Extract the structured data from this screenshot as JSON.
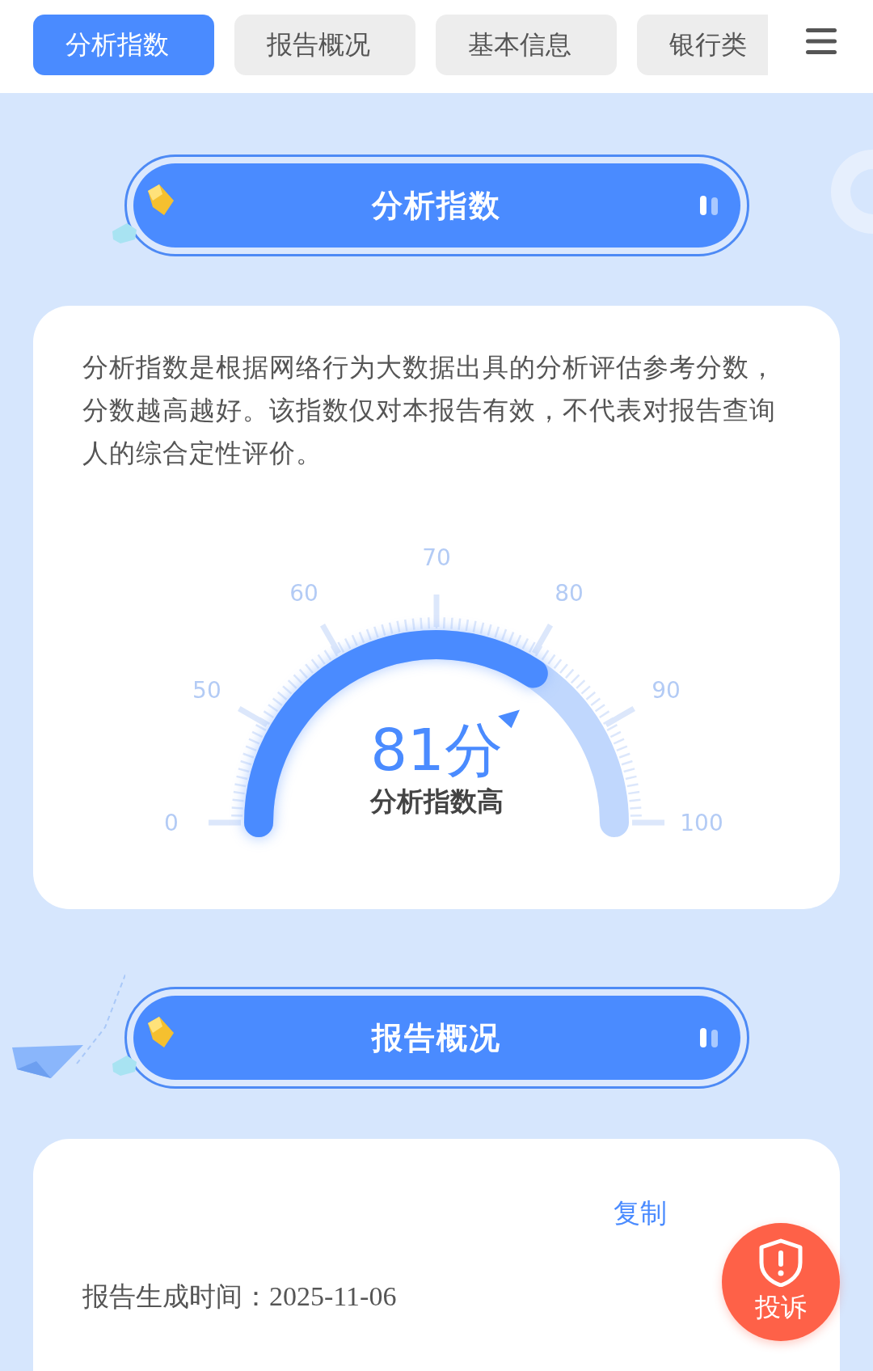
{
  "nav": {
    "tabs": [
      {
        "label": "分析指数",
        "selected": true
      },
      {
        "label": "报告概况",
        "selected": false
      },
      {
        "label": "基本信息",
        "selected": false
      },
      {
        "label": "银行类",
        "selected": false
      }
    ]
  },
  "sections": [
    {
      "kind": "score",
      "title": "分析指数",
      "description": "分析指数是根据网络行为大数据出具的分析评估参考分数，分数越高越好。该指数仅对本报告有效，不代表对报告查询人的综合定性评价。",
      "gauge": {
        "ticks": [
          "0",
          "50",
          "60",
          "70",
          "80",
          "90",
          "100"
        ],
        "level": 0.81,
        "score": "81分",
        "verdict": "分析指数高"
      }
    },
    {
      "kind": "overview",
      "title": "报告概况",
      "copy_link": "复制",
      "fields": [
        {
          "label": "报告生成时间：",
          "value": "2025-11-06"
        }
      ]
    }
  ],
  "complaint_button": {
    "label": "投诉"
  }
}
